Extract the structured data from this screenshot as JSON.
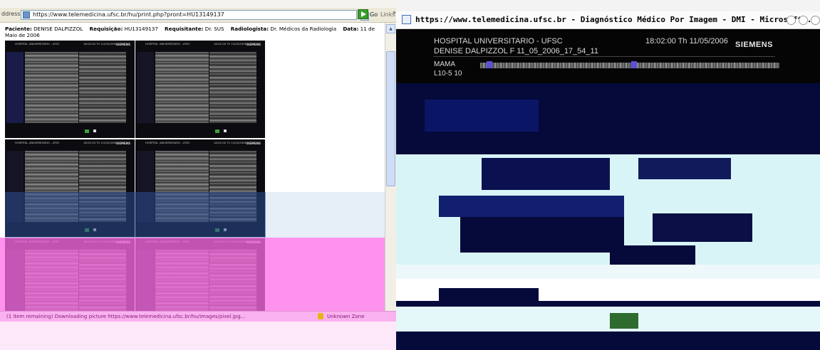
{
  "left_window": {
    "address_label": "ddress",
    "url": "https://www.telemedicina.ufsc.br/hu/print.php?pront=HU13149137",
    "dropdown_glyph": "▼",
    "go_label": "Go",
    "links_label": "Links",
    "links_chevron": "»",
    "patient": {
      "paciente_label": "Paciente:",
      "paciente_value": "DENISE DALPIZZOL",
      "requisicao_label": "Requisição:",
      "requisicao_value": "HU13149137",
      "requisitante_label": "Requisitante:",
      "requisitante_value": "Dr. SUS",
      "radiologista_label": "Radiologista:",
      "radiologista_value": "Dr. Médicos da Radiologia",
      "data_label": "Data:",
      "data_value": "11 de Maio de 2006"
    },
    "thumb_header": "HOSPITAL UNIVERSITARIO - UFSC",
    "thumb_time": "18:02:00  Th 11/05/2006",
    "thumb_logo": "SIEMENS",
    "scroll_up_glyph": "▲",
    "status_text": "(1 item remaining) Downloading picture https://www.telemedicina.ufsc.br/hu/images/pixel.jpg...",
    "zone_text": "Unknown Zone"
  },
  "right_window": {
    "title": "https://www.telemedicina.ufsc.br - Diagnóstico Médico Por Imagem - DMI - Microsoft ...",
    "hospital": "HOSPITAL UNIVERSITARIO - UFSC",
    "patient_line": "DENISE DALPIZZOL F 11_05_2006_17_54_11",
    "timestamp": "18:02:00   Th 11/05/2006",
    "logo": "SIEMENS",
    "body_line1": "MAMA",
    "body_line2": "L10-5   10"
  },
  "colors": {
    "ultrasound_bg": "#050505",
    "pink_overlay": "#ff6ee6",
    "blue_overlay": "#2d5096",
    "glitch_navy": "#050a3a",
    "glitch_cyan": "#d9f4f7"
  }
}
